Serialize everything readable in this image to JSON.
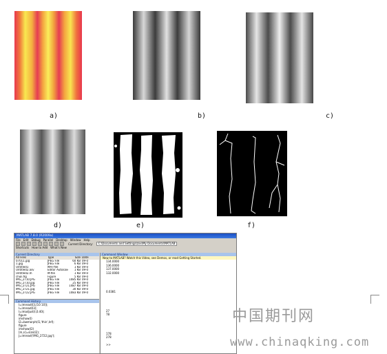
{
  "captions": {
    "a": "a)",
    "b": "b)",
    "c": "c)",
    "d": "d)",
    "e": "e)",
    "f": "f)"
  },
  "matlab": {
    "title": "MATLAB  7.8.0 (R2009a)",
    "menu": [
      "File",
      "Edit",
      "Debug",
      "Parallel",
      "Desktop",
      "Window",
      "Help"
    ],
    "current_directory_label": "Current Directory:",
    "current_directory_value": "C:\\Documents and Settings\\zxx\\My Documents\\MATLAB",
    "shortcuts": [
      "Shortcuts",
      "How to Add",
      "What's New"
    ],
    "current_directory_pane": "Current Directory",
    "file_columns": [
      "All Files",
      "Type",
      "Size",
      "Date"
    ],
    "files": [
      [
        "07011.jpg",
        "JPEG File",
        "60 KB",
        "09-0"
      ],
      [
        "1.jpg",
        "JPEG File",
        "6 KB",
        "09-0"
      ],
      [
        "Untitled1",
        "MAT-file",
        "1 KB",
        "09-0"
      ],
      [
        "Untitled2.asv",
        "Editor Autosave",
        "1 KB",
        "09-0"
      ],
      [
        "Untitled2.m",
        "M-file",
        "1 KB",
        "09-0"
      ],
      [
        "chuli.fig",
        "Figure",
        "5 KB",
        "09-0"
      ],
      [
        "IMG_2710.JPG",
        "JPEG File",
        "1085 KB",
        "09-0"
      ],
      [
        "IMG_2710.jpg",
        "JPEG File",
        "25 KB",
        "09-0"
      ],
      [
        "IMG_2721.JPG",
        "JPEG File",
        "1487 KB",
        "09-0"
      ],
      [
        "IMG_2721.jpg",
        "JPEG File",
        "30 KB",
        "09-0"
      ],
      [
        "IMG_2722.JPG",
        "JPEG File",
        "1083 KB",
        "09-0"
      ]
    ],
    "history_pane": "Command History",
    "history": [
      "I=imread(I3,[10 10]);",
      "I=imread(I3);",
      "I=imadjust(I,0.40);",
      "figure",
      "imshow(I)",
      "I2=bwmorph(I1,'thin',Inf);",
      "figure",
      "imshow(I2)",
      "[m,n]=size(I2);",
      "J=imread('IMG_2722.jpg');"
    ],
    "command_pane": "Command Window",
    "command_notice": "New to MATLAB? Watch this Video, see Demos, or read Getting Started.",
    "command_lines": [
      "134.0000",
      "136.0000",
      "137.0000",
      "132.0000",
      "",
      "",
      "",
      "",
      "0.0381",
      "",
      "",
      "",
      "",
      "27",
      "78",
      "",
      "",
      "",
      "",
      "178",
      "278",
      "",
      ">>"
    ]
  },
  "watermark": {
    "chinese": "中国期刊网",
    "url": "www.chinaqking.com"
  }
}
